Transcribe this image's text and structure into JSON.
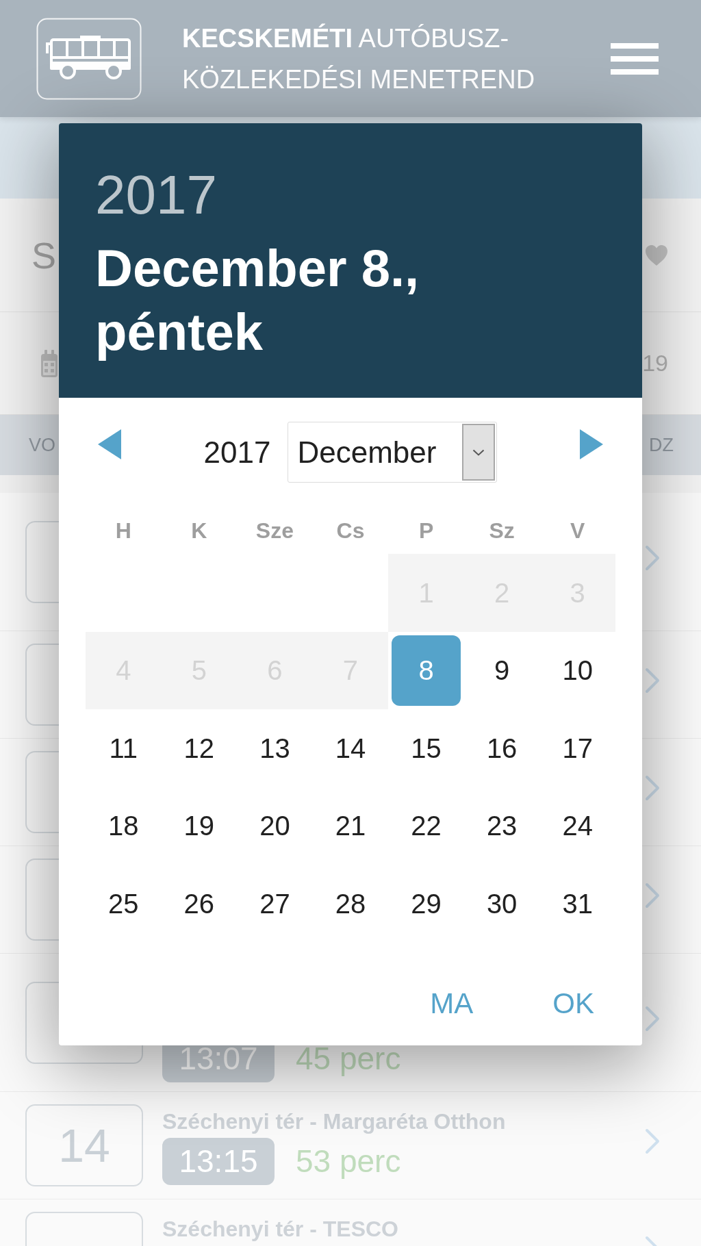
{
  "header": {
    "title": "**KECSKEMÉTI** AUTÓBUSZ-KÖZLEKEDÉSI MENETREND"
  },
  "stop": {
    "title": "S",
    "date": "19"
  },
  "columns": [
    "VO",
    "DZ"
  ],
  "departures": [
    {
      "kind": "tall"
    },
    {
      "kind": "short"
    },
    {
      "kind": "short"
    },
    {
      "kind": "short"
    },
    {
      "kind": "tall",
      "time": "13:07",
      "duration": "45 perc"
    },
    {
      "kind": "short",
      "line": "14",
      "route": "Széchenyi tér - Margaréta Otthon",
      "time": "13:15",
      "duration": "53 perc"
    },
    {
      "kind": "short",
      "route": "Széchenyi tér - TESCO"
    }
  ],
  "date_picker": {
    "year": "2017",
    "date": "December 8., péntek",
    "nav": {
      "year": "2017",
      "month": "December"
    },
    "weekdays": [
      "H",
      "K",
      "Sze",
      "Cs",
      "P",
      "Sz",
      "V"
    ],
    "weeks": [
      [
        {
          "kind": "blank"
        },
        {
          "kind": "blank"
        },
        {
          "kind": "blank"
        },
        {
          "kind": "blank"
        },
        {
          "kind": "day",
          "day": "1",
          "disabled": true,
          "selected": false
        },
        {
          "kind": "day",
          "day": "2",
          "disabled": true,
          "selected": false
        },
        {
          "kind": "day",
          "day": "3",
          "disabled": true,
          "selected": false
        }
      ],
      [
        {
          "kind": "day",
          "day": "4",
          "disabled": true,
          "selected": false
        },
        {
          "kind": "day",
          "day": "5",
          "disabled": true,
          "selected": false
        },
        {
          "kind": "day",
          "day": "6",
          "disabled": true,
          "selected": false
        },
        {
          "kind": "day",
          "day": "7",
          "disabled": true,
          "selected": false
        },
        {
          "kind": "day",
          "day": "8",
          "disabled": false,
          "selected": true
        },
        {
          "kind": "day",
          "day": "9",
          "disabled": false,
          "selected": false
        },
        {
          "kind": "day",
          "day": "10",
          "disabled": false,
          "selected": false
        }
      ],
      [
        {
          "kind": "day",
          "day": "11",
          "disabled": false,
          "selected": false
        },
        {
          "kind": "day",
          "day": "12",
          "disabled": false,
          "selected": false
        },
        {
          "kind": "day",
          "day": "13",
          "disabled": false,
          "selected": false
        },
        {
          "kind": "day",
          "day": "14",
          "disabled": false,
          "selected": false
        },
        {
          "kind": "day",
          "day": "15",
          "disabled": false,
          "selected": false
        },
        {
          "kind": "day",
          "day": "16",
          "disabled": false,
          "selected": false
        },
        {
          "kind": "day",
          "day": "17",
          "disabled": false,
          "selected": false
        }
      ],
      [
        {
          "kind": "day",
          "day": "18",
          "disabled": false,
          "selected": false
        },
        {
          "kind": "day",
          "day": "19",
          "disabled": false,
          "selected": false
        },
        {
          "kind": "day",
          "day": "20",
          "disabled": false,
          "selected": false
        },
        {
          "kind": "day",
          "day": "21",
          "disabled": false,
          "selected": false
        },
        {
          "kind": "day",
          "day": "22",
          "disabled": false,
          "selected": false
        },
        {
          "kind": "day",
          "day": "23",
          "disabled": false,
          "selected": false
        },
        {
          "kind": "day",
          "day": "24",
          "disabled": false,
          "selected": false
        }
      ],
      [
        {
          "kind": "day",
          "day": "25",
          "disabled": false,
          "selected": false
        },
        {
          "kind": "day",
          "day": "26",
          "disabled": false,
          "selected": false
        },
        {
          "kind": "day",
          "day": "27",
          "disabled": false,
          "selected": false
        },
        {
          "kind": "day",
          "day": "28",
          "disabled": false,
          "selected": false
        },
        {
          "kind": "day",
          "day": "29",
          "disabled": false,
          "selected": false
        },
        {
          "kind": "day",
          "day": "30",
          "disabled": false,
          "selected": false
        },
        {
          "kind": "day",
          "day": "31",
          "disabled": false,
          "selected": false
        }
      ]
    ],
    "buttons": [
      "MA",
      "OK"
    ]
  }
}
